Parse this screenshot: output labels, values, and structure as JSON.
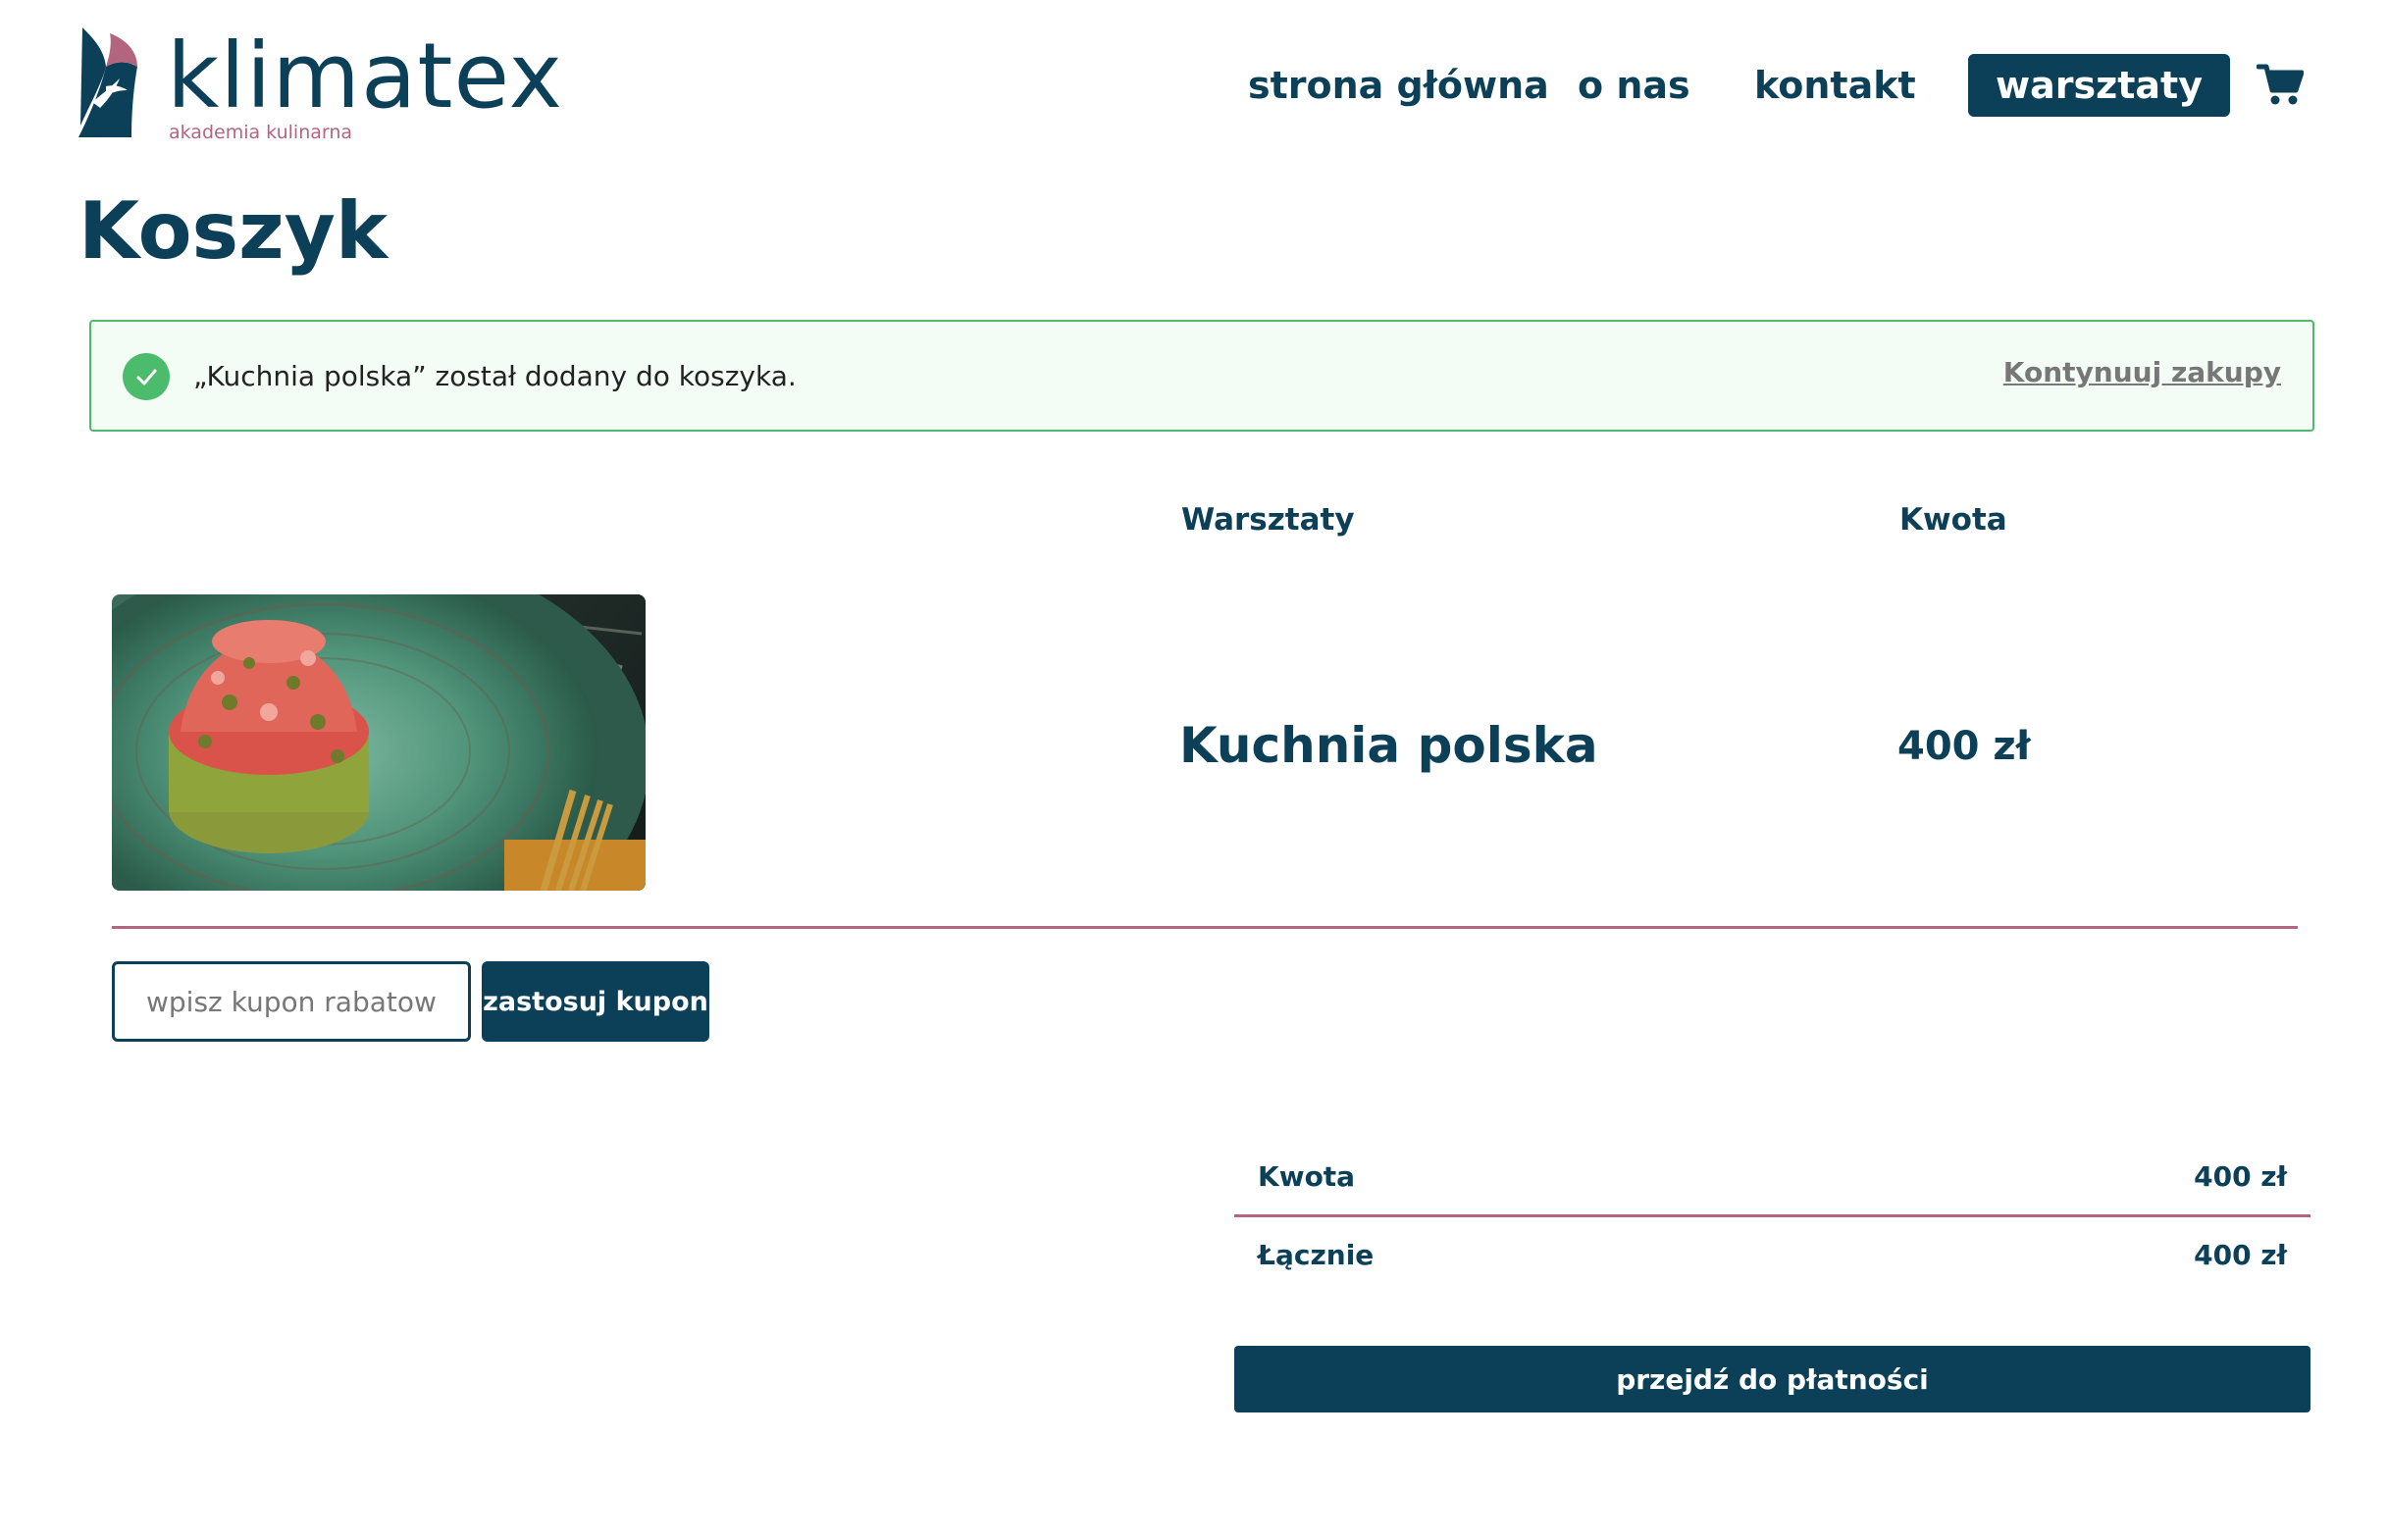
{
  "brand": {
    "name": "klimatex",
    "tagline": "akademia kulinarna",
    "logo_icon": "seagull-sail-icon",
    "colors": {
      "primary": "#0c4058",
      "accent": "#b3657f",
      "success": "#4cbb6c"
    }
  },
  "nav": {
    "items": [
      {
        "label": "strona główna",
        "active": false
      },
      {
        "label": "o nas",
        "active": false
      },
      {
        "label": "kontakt",
        "active": false
      },
      {
        "label": "warsztaty",
        "active": true
      }
    ],
    "cart_icon": "shopping-cart-icon"
  },
  "page": {
    "title": "Koszyk"
  },
  "notice": {
    "icon": "check-circle-icon",
    "message": "„Kuchnia polska” został dodany do koszyka.",
    "link_label": "Kontynuuj zakupy"
  },
  "cart": {
    "columns": {
      "product": "Warsztaty",
      "amount": "Kwota"
    },
    "items": [
      {
        "name": "Kuchnia polska",
        "price": "400 zł",
        "image": "tartare-on-green-plate"
      }
    ]
  },
  "coupon": {
    "placeholder": "wpisz kupon rabatowy",
    "value": "",
    "button_label": "zastosuj kupon"
  },
  "totals": {
    "subtotal_label": "Kwota",
    "subtotal_value": "400 zł",
    "total_label": "Łącznie",
    "total_value": "400 zł"
  },
  "checkout": {
    "button_label": "przejdź do płatności"
  }
}
